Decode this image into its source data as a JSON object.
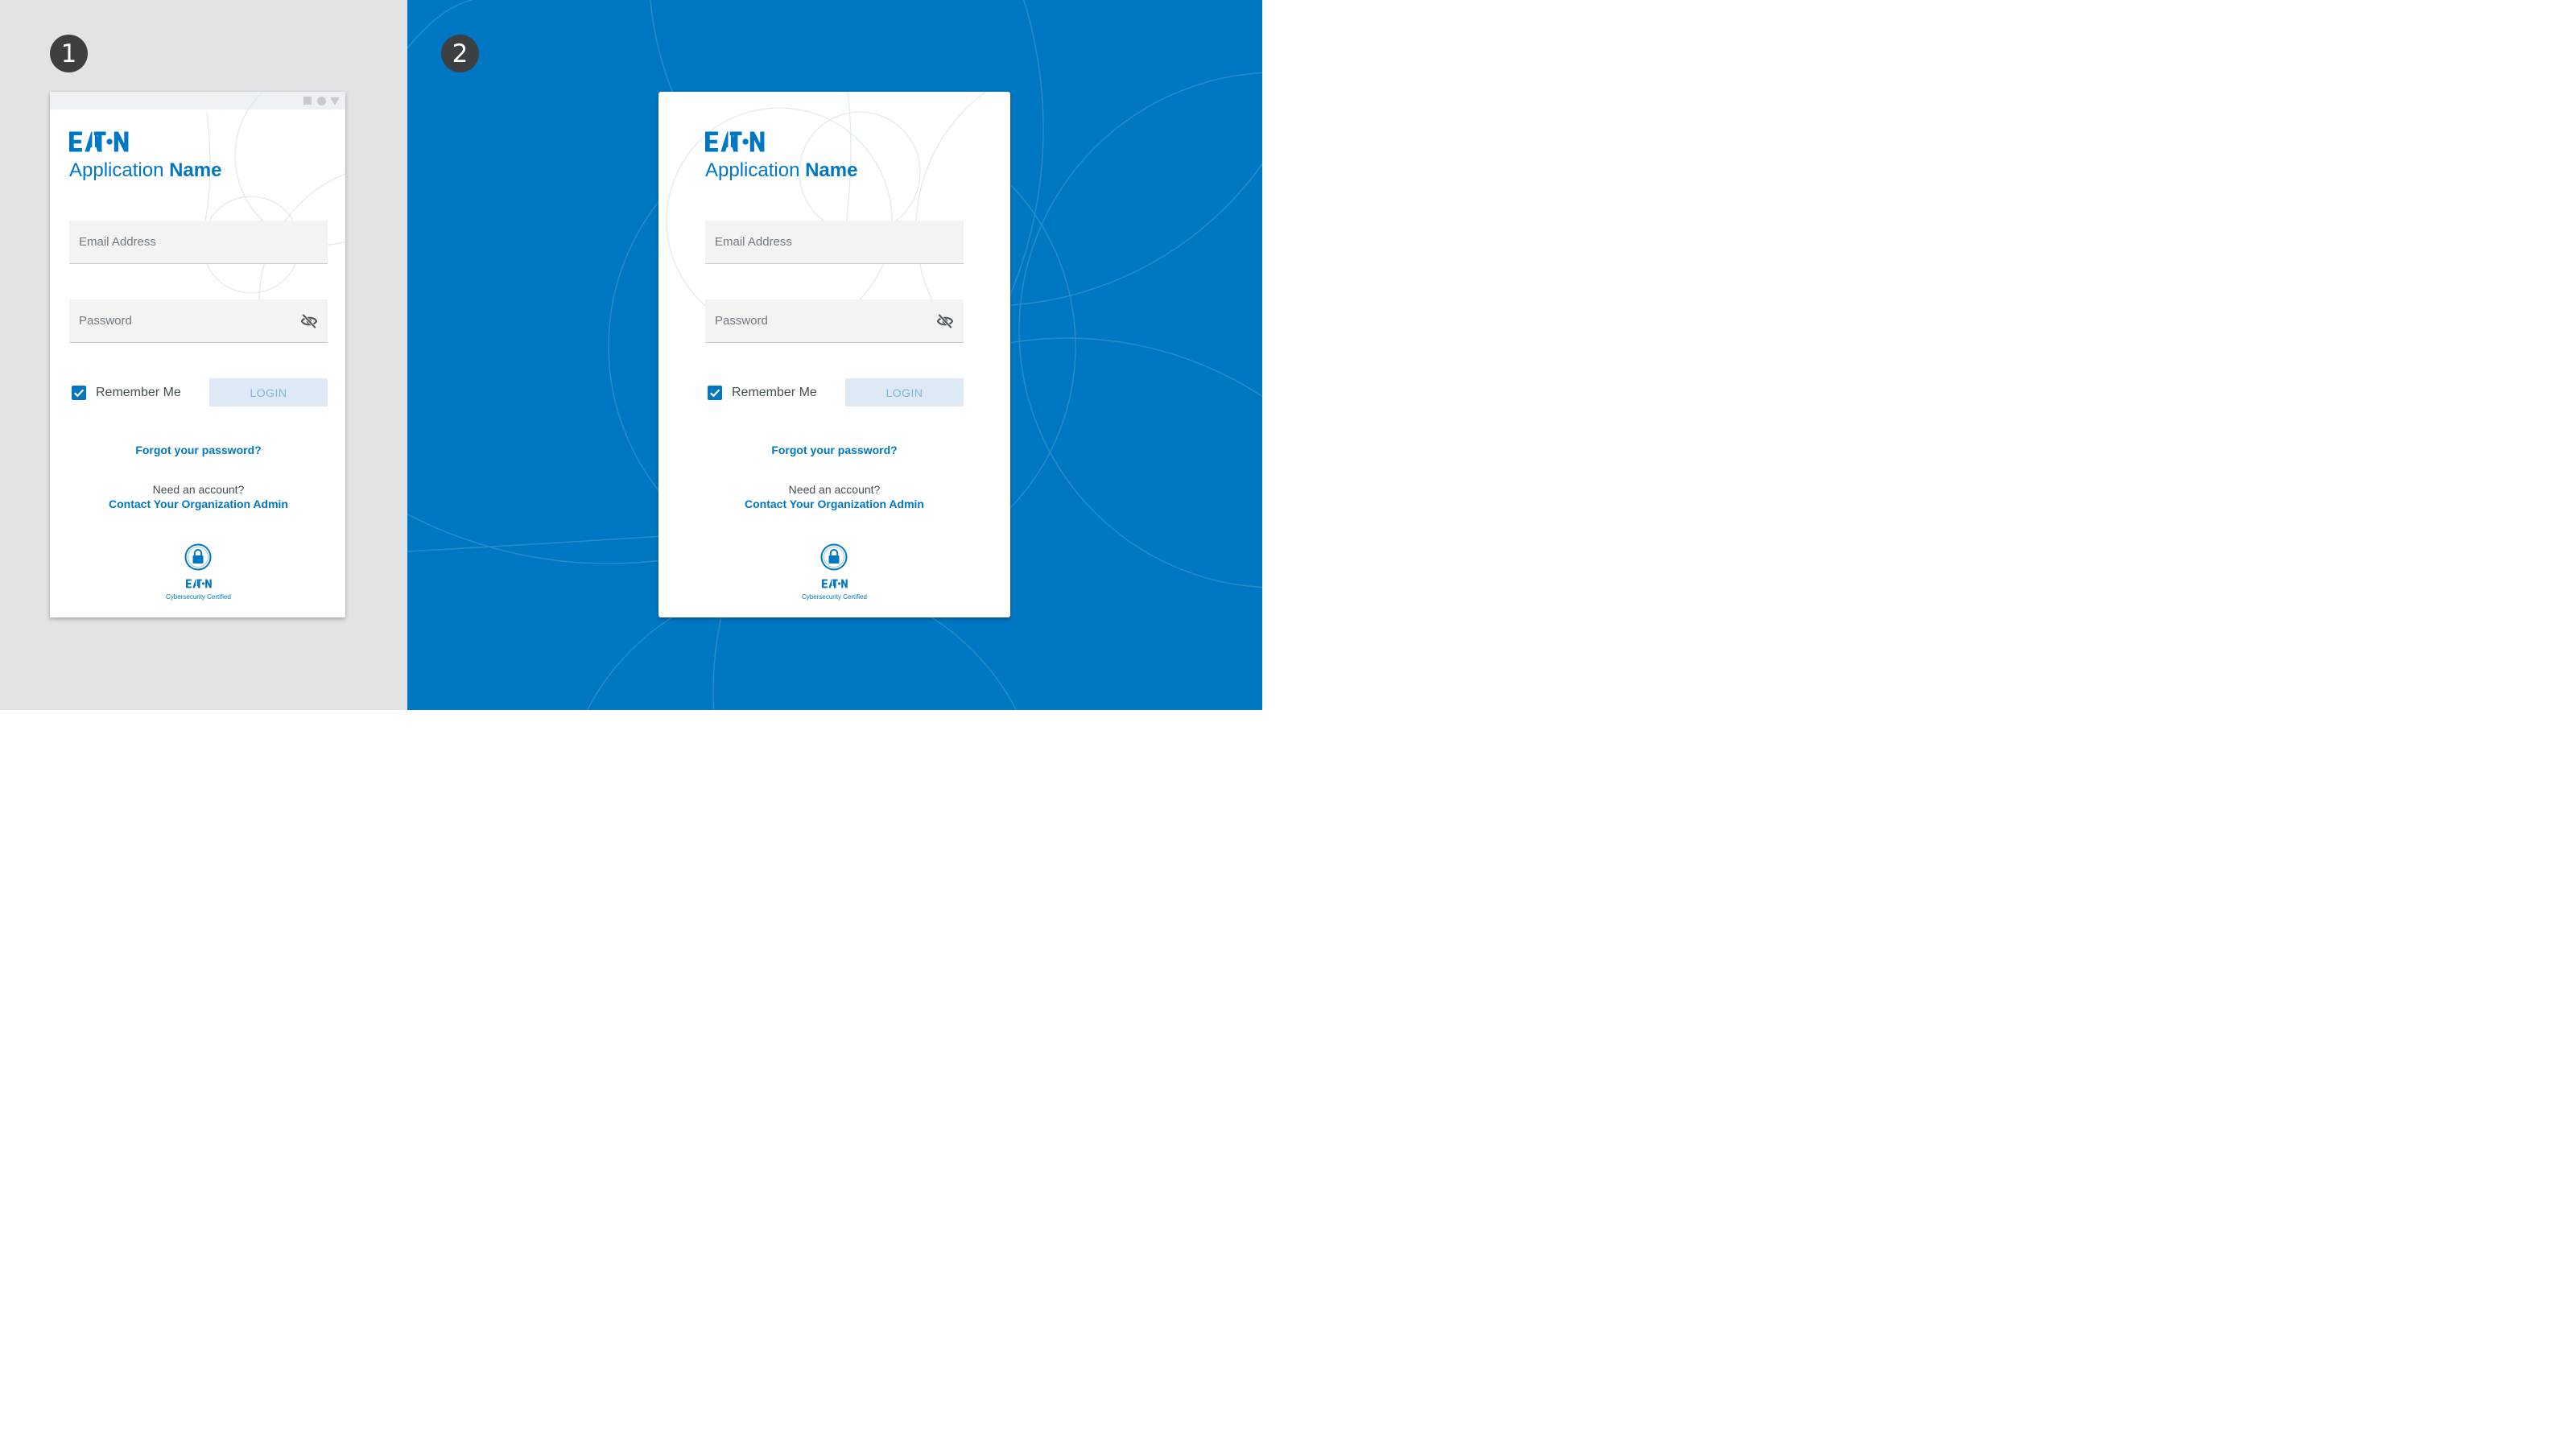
{
  "steps": {
    "first": "1",
    "second": "2"
  },
  "login_card": {
    "brand_logo": "EATON",
    "app_title_light": "Application",
    "app_title_bold": "Name",
    "email_placeholder": "Email Address",
    "email_value": "",
    "password_placeholder": "Password",
    "password_value": "",
    "password_visibility_icon": "eye-off-icon",
    "remember_label": "Remember Me",
    "remember_checked": true,
    "login_label": "LOGIN",
    "forgot_link": "Forgot your password?",
    "need_account": "Need an account?",
    "contact_link": "Contact Your Organization Admin",
    "cert_icon": "lock-badge-icon",
    "cert_brand": "EATON",
    "cert_text": "Cybersecurity Certified"
  },
  "colors": {
    "brand_blue": "#0077c2",
    "left_background": "#e1e4e6",
    "badge": "#3c4043",
    "login_disabled_bg": "#dde9f4",
    "login_disabled_text": "#7db5dd",
    "field_bg": "#f2f4f4"
  }
}
